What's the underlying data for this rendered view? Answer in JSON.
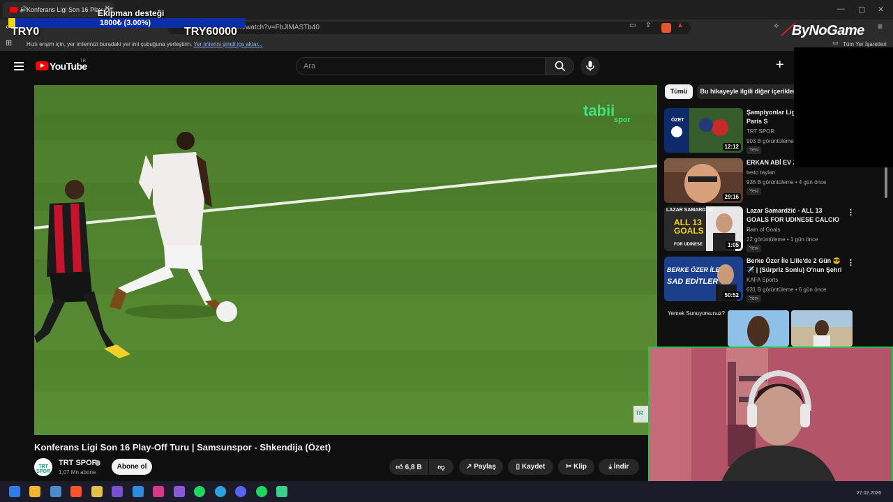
{
  "browser": {
    "tab_title": "Konferans Ligi Son 16 Play-Off Tur",
    "url": "youtube.com/watch?v=FbJlMASTb40",
    "bookmarks_message": "Hızlı erişim için, yer imlerinizi buradaki yer imi çubuğuna yerleştirin.",
    "bookmarks_link": "Yer imlerini şimdi içe aktar...",
    "all_bookmarks": "Tüm Yer İşaretleri"
  },
  "overlay": {
    "goal_title": "Ekipman desteği",
    "goal_amount": "1800₺ (3.00%)",
    "goal_progress": 0.03,
    "goal_min": "TRY0",
    "goal_max": "TRY60000",
    "brand": "ByNoGame",
    "colors": {
      "goal_track": "#0a2ea8",
      "goal_fill": "#f3d21a",
      "brand_red": "#e02020"
    }
  },
  "youtube": {
    "logo_text": "YouTube",
    "logo_region": "TR",
    "search_placeholder": "Ara",
    "icons": [
      "menu-icon",
      "search-icon",
      "mic-icon",
      "plus-icon"
    ]
  },
  "video": {
    "title": "Konferans Ligi Son 16 Play-Off Turu | Samsunspor - Shkendija (Özet)",
    "watermark": "tabii",
    "watermark_sub": "spor",
    "corner_badge": "TR",
    "channel": {
      "name": "TRT SPOR",
      "subscribers": "1,07 Mn abone",
      "avatar_text": "TRT SPOR",
      "subscribe_label": "Abone ol"
    },
    "actions": {
      "likes": "6,8 B",
      "share": "Paylaş",
      "save": "Kaydet",
      "clip": "Klip",
      "download": "İndir"
    }
  },
  "sidebar": {
    "chips": [
      "Tümü",
      "Bu hikayeyle ilgili diğer içerikler"
    ],
    "recommendations": [
      {
        "title": "Şampiyonlar Ligi Play-Off Turu | Paris S",
        "channel": "TRT SPOR",
        "meta": "903 B görüntüleme",
        "badge": "Yeni",
        "duration": "12:12",
        "thumb_text": "ÖZET"
      },
      {
        "title": "ERKAN ABİ EV Z",
        "channel": "testo taylan",
        "meta": "936 B görüntüleme • 4 gün önce",
        "badge": "Yeni",
        "duration": "29:16",
        "thumb_text": ""
      },
      {
        "title": "Lazar Samardžić - ALL 13 GOALS FOR UDINESE CALCIO ...",
        "channel": "Rain of Goals",
        "meta": "22 görüntüleme • 1 gün önce",
        "badge": "Yeni",
        "duration": "1:05",
        "thumb_text": "LAZAR SAMARDŽIĆ",
        "thumb_text2": "ALL 13 GOALS",
        "thumb_text3": "FOR UDINESE"
      },
      {
        "title": "Berke Özer İle Lille'de 2 Gün 😎 ✈️ | (Sürpriz Sonlu) O'nun Şehri",
        "channel": "KAFA Sports",
        "meta": "631 B görüntüleme • 6 gün önce",
        "badge": "Yeni",
        "duration": "50:52",
        "thumb_text": "BERKE ÖZER İLE",
        "thumb_text2": "SAD EDİTLER"
      }
    ],
    "shorts_label": "Yemek Sunuyorsunuz?"
  },
  "taskbar": {
    "date": "27.02.2026",
    "apps": [
      "windows-icon",
      "file-explorer-icon",
      "monitor-icon",
      "brave-icon",
      "paint-icon",
      "visual-studio-icon",
      "vscode-icon",
      "instagram-icon",
      "pen-icon",
      "spotify-icon",
      "telegram-icon",
      "discord-icon",
      "spotify-alt-icon",
      "android-icon"
    ]
  }
}
